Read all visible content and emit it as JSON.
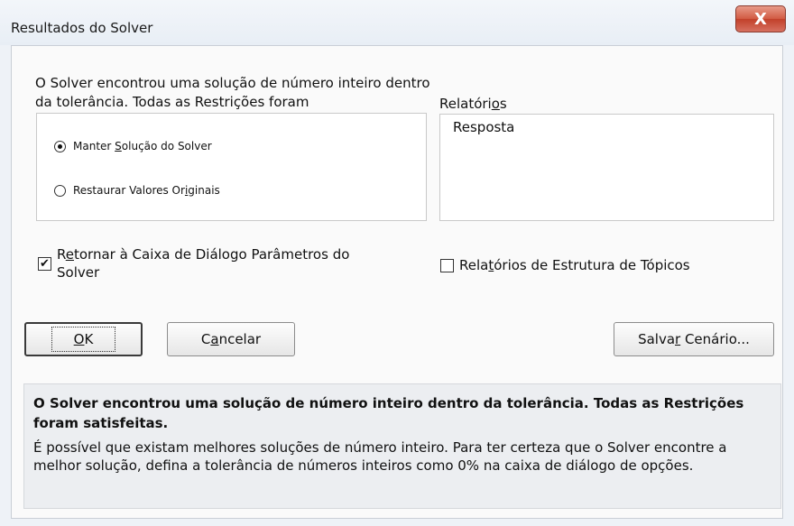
{
  "window": {
    "title": "Resultados do Solver",
    "close_glyph": "X"
  },
  "message": "O Solver encontrou uma solução de número inteiro dentro da tolerância. Todas as Restrições foram",
  "options": {
    "keep_solution": {
      "pre": "Manter ",
      "acc": "S",
      "post": "olução do Solver",
      "checked": true
    },
    "restore_values": {
      "pre": "Restaurar Valores Or",
      "acc": "i",
      "post": "ginais",
      "checked": false
    }
  },
  "reports": {
    "label_pre": "Relatóri",
    "label_acc": "o",
    "label_post": "s",
    "items": [
      "Resposta"
    ]
  },
  "return_dialog": {
    "pre": "R",
    "acc": "e",
    "post": "tornar à Caixa de Diálogo Parâmetros do",
    "line2": "Solver",
    "checked": true,
    "glyph": "✔"
  },
  "outline_reports": {
    "pre": "Rela",
    "acc": "t",
    "post": "órios de Estrutura de Tópicos",
    "checked": false
  },
  "buttons": {
    "ok": {
      "acc": "O",
      "post": "K"
    },
    "cancel": {
      "pre": "C",
      "acc": "a",
      "post": "ncelar"
    },
    "save_scenario": {
      "pre": "Salva",
      "acc": "r",
      "post": " Cenário..."
    }
  },
  "info": {
    "bold": "O Solver encontrou uma solução de número inteiro dentro da tolerância. Todas as Restrições foram satisfeitas.",
    "text": "É possível que existam melhores soluções de número inteiro. Para ter certeza que o Solver encontre a melhor solução, defina a tolerância de números inteiros como 0% na caixa de diálogo de opções."
  }
}
